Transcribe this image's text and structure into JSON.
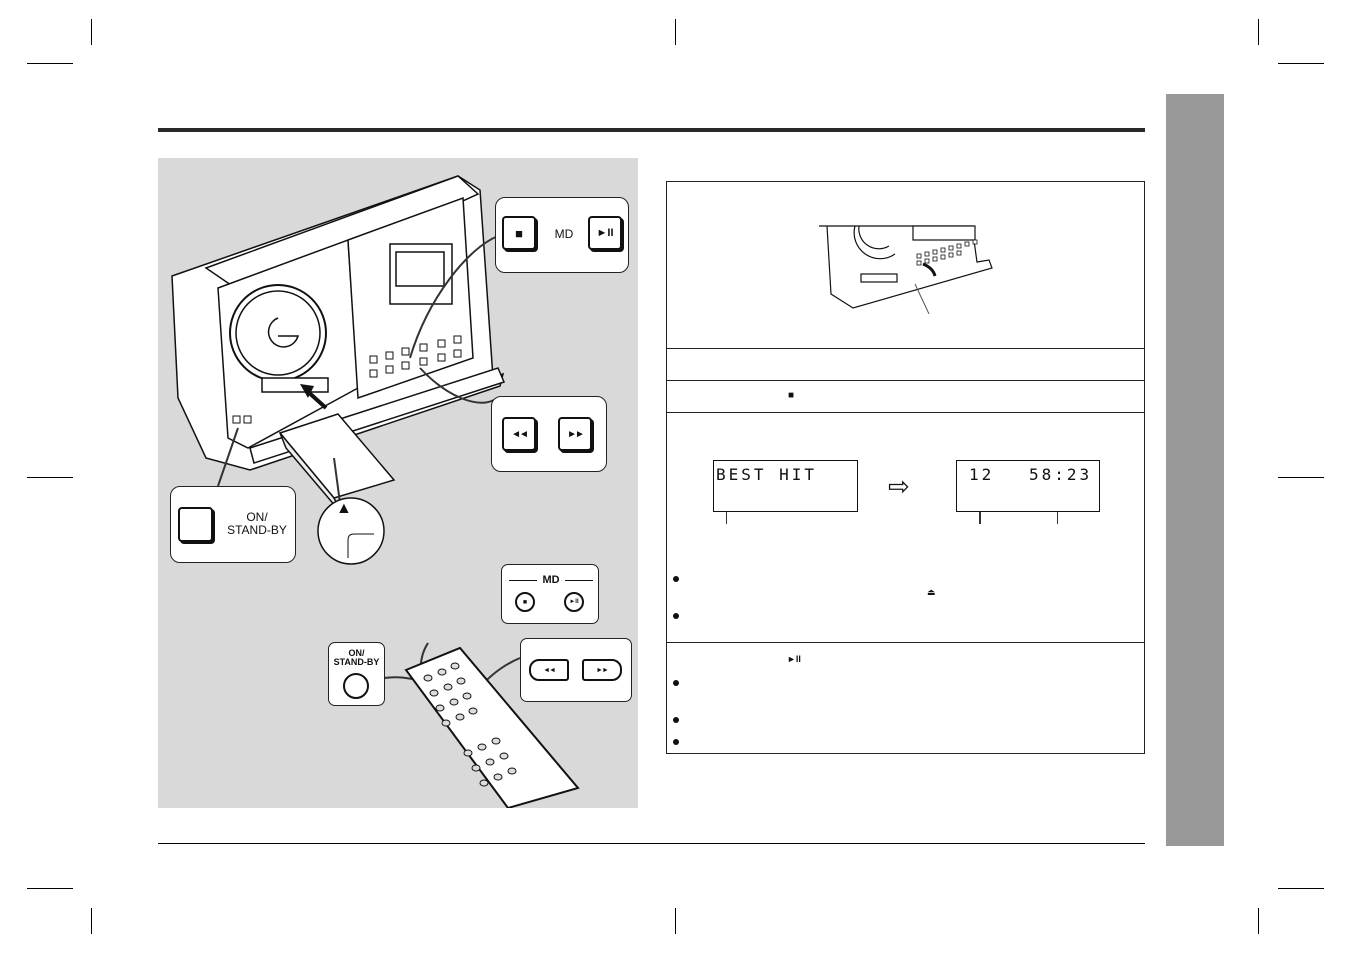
{
  "page": {
    "side_tab_color": "#999999",
    "illustration_bg": "#d9d9d9"
  },
  "main_unit_callouts": {
    "md_stop_play": {
      "stop_icon": "stop-icon",
      "stop_glyph": "■",
      "label": "MD",
      "play_pause_icon": "play-pause-icon",
      "play_pause_glyph": "►II"
    },
    "skip": {
      "prev_icon": "skip-previous-icon",
      "prev_glyph": "◄◄",
      "next_icon": "skip-next-icon",
      "next_glyph": "►►"
    },
    "power": {
      "label_line1": "ON/",
      "label_line2": "STAND-BY"
    },
    "disc_insert_mark": {
      "icon": "triangle-up-icon",
      "glyph": "▲"
    }
  },
  "remote_callouts": {
    "md": {
      "label": "MD",
      "stop_glyph": "■",
      "play_pause_glyph": "►II"
    },
    "power": {
      "label_line1": "ON/",
      "label_line2": "STAND-BY"
    },
    "skip": {
      "prev_glyph": "◄◄",
      "next_glyph": "►►"
    }
  },
  "steps": {
    "step2_icon": "stop-icon",
    "step2_glyph": "■",
    "display_before": "BEST HIT",
    "display_after_track": "12",
    "display_after_time": "58:23",
    "arrow_icon": "hollow-arrow-right-icon",
    "arrow_glyph": "⇨",
    "eject_icon": "eject-icon",
    "eject_glyph": "⏏",
    "step4_icon": "play-pause-icon",
    "step4_glyph": "►II"
  }
}
